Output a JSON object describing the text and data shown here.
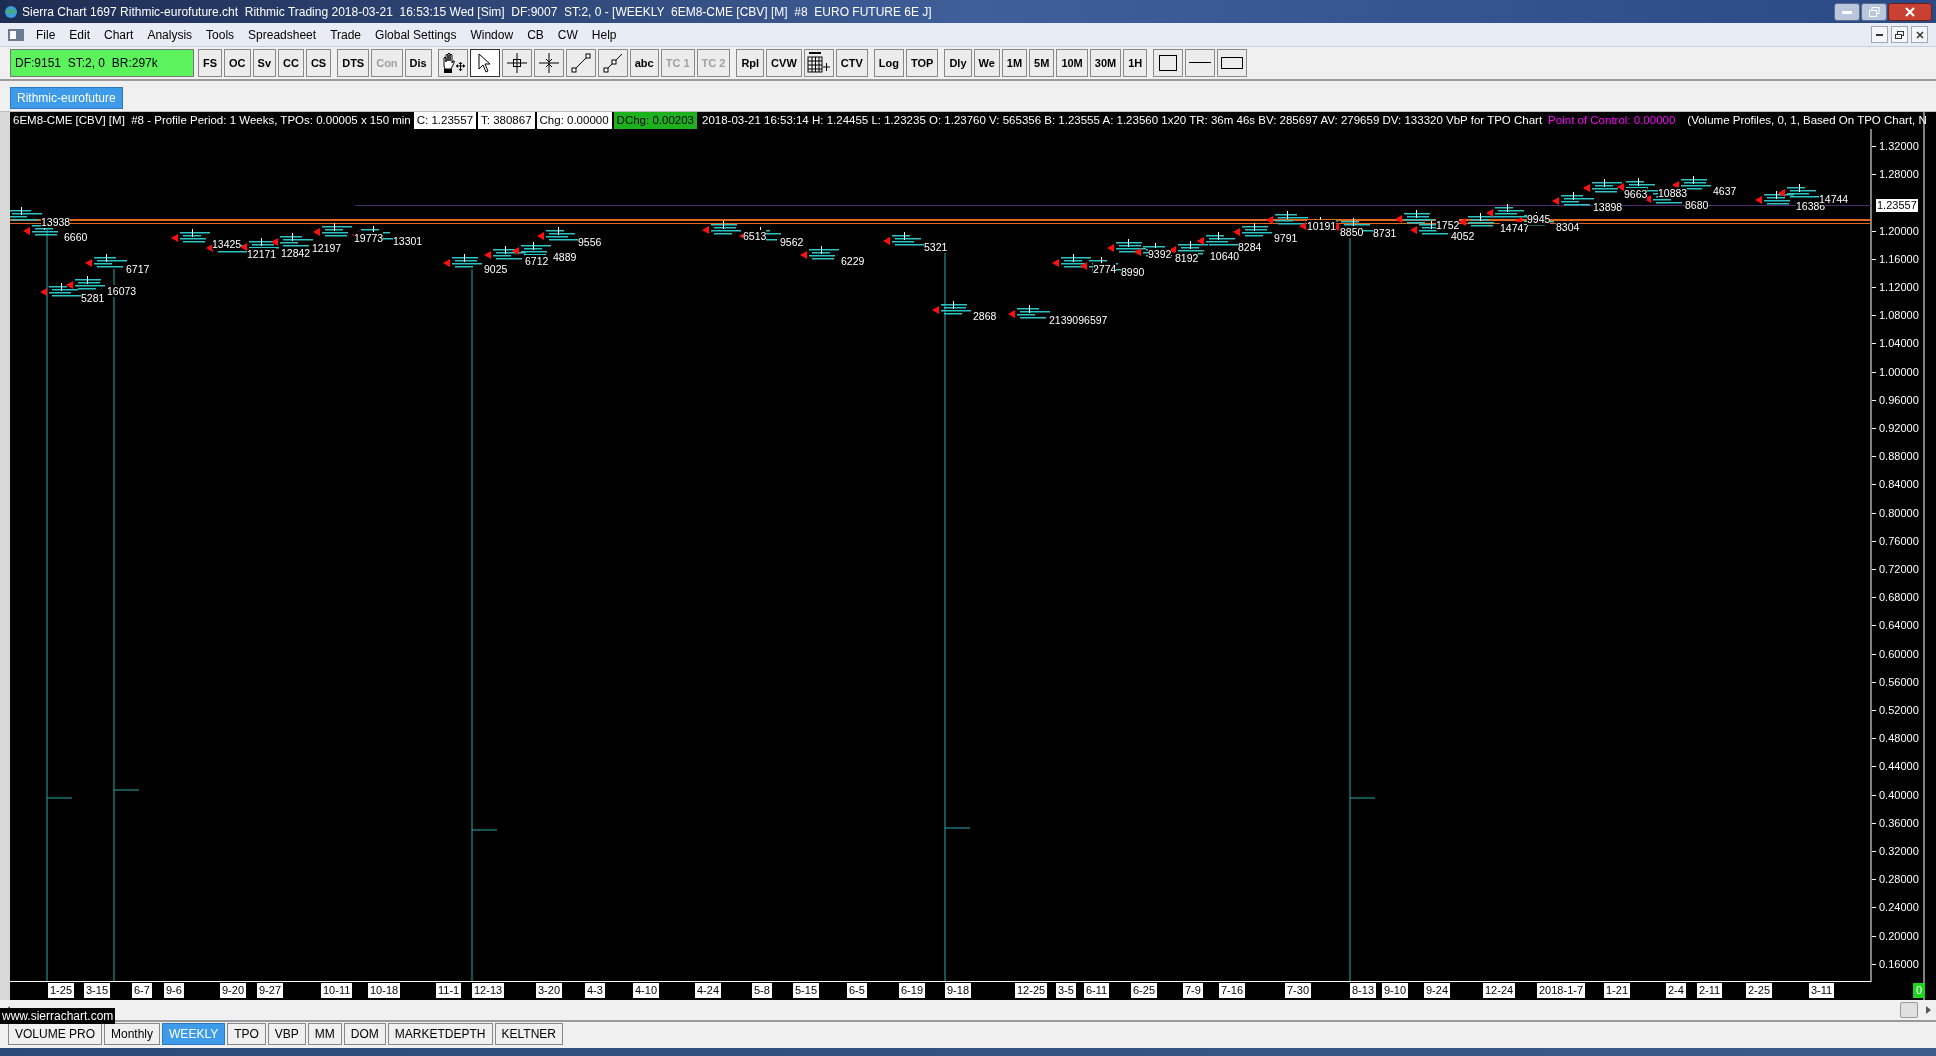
{
  "window": {
    "title": "Sierra Chart 1697 Rithmic-eurofuture.cht  Rithmic Trading 2018-03-21  16:53:15 Wed [Sim]  DF:9007  ST:2, 0 - [WEEKLY  6EM8-CME [CBV] [M]  #8  EURO FUTURE 6E J]"
  },
  "menu": [
    "File",
    "Edit",
    "Chart",
    "Analysis",
    "Tools",
    "Spreadsheet",
    "Trade",
    "Global Settings",
    "Window",
    "CB",
    "CW",
    "Help"
  ],
  "status_box": "DF:9151  ST:2, 0  BR:297k",
  "toolbar": [
    {
      "kind": "text",
      "label": "FS",
      "disabled": false,
      "selected": false
    },
    {
      "kind": "text",
      "label": "OC",
      "disabled": false,
      "selected": false
    },
    {
      "kind": "text",
      "label": "Sv",
      "disabled": false,
      "selected": false
    },
    {
      "kind": "text",
      "label": "CC",
      "disabled": false,
      "selected": false
    },
    {
      "kind": "text",
      "label": "CS",
      "disabled": false,
      "selected": false
    },
    {
      "kind": "text",
      "label": "DTS",
      "disabled": false,
      "selected": false
    },
    {
      "kind": "text",
      "label": "Con",
      "disabled": true,
      "selected": false
    },
    {
      "kind": "text",
      "label": "Dis",
      "disabled": false,
      "selected": false
    },
    {
      "kind": "hand",
      "disabled": false,
      "selected": false
    },
    {
      "kind": "pointer",
      "disabled": false,
      "selected": true
    },
    {
      "kind": "crosshair",
      "disabled": false,
      "selected": false
    },
    {
      "kind": "marker",
      "disabled": false,
      "selected": false
    },
    {
      "kind": "line",
      "disabled": false,
      "selected": false
    },
    {
      "kind": "ray",
      "disabled": false,
      "selected": false
    },
    {
      "kind": "text",
      "label": "abc",
      "disabled": false,
      "selected": false
    },
    {
      "kind": "text",
      "label": "TC 1",
      "disabled": true,
      "selected": false
    },
    {
      "kind": "text",
      "label": "TC 2",
      "disabled": true,
      "selected": false
    },
    {
      "kind": "text",
      "label": "Rpl",
      "disabled": false,
      "selected": false
    },
    {
      "kind": "text",
      "label": "CVW",
      "disabled": false,
      "selected": false
    },
    {
      "kind": "grid",
      "disabled": false,
      "selected": false
    },
    {
      "kind": "text",
      "label": "CTV",
      "disabled": false,
      "selected": false
    },
    {
      "kind": "text",
      "label": "Log",
      "disabled": false,
      "selected": false
    },
    {
      "kind": "text",
      "label": "TOP",
      "disabled": false,
      "selected": false
    },
    {
      "kind": "text",
      "label": "Dly",
      "disabled": false,
      "selected": false
    },
    {
      "kind": "text",
      "label": "We",
      "disabled": false,
      "selected": false
    },
    {
      "kind": "text",
      "label": "1M",
      "disabled": false,
      "selected": false
    },
    {
      "kind": "text",
      "label": "5M",
      "disabled": false,
      "selected": false
    },
    {
      "kind": "text",
      "label": "10M",
      "disabled": false,
      "selected": false
    },
    {
      "kind": "text",
      "label": "30M",
      "disabled": false,
      "selected": false
    },
    {
      "kind": "text",
      "label": "1H",
      "disabled": false,
      "selected": false
    },
    {
      "kind": "rectangle",
      "disabled": false,
      "selected": false
    },
    {
      "kind": "hline",
      "disabled": false,
      "selected": false
    },
    {
      "kind": "box",
      "disabled": false,
      "selected": false
    }
  ],
  "chart_tabs": [
    {
      "label": "Rithmic-eurofuture",
      "selected": true
    }
  ],
  "info_line": [
    {
      "kind": "plain",
      "text": "6EM8-CME [CBV] [M]  #8 - Profile Period: 1 Weeks, TPOs: 0.00005 x 150 min"
    },
    {
      "kind": "boxed",
      "text": "C: 1.23557"
    },
    {
      "kind": "boxed",
      "text": "T: 380867"
    },
    {
      "kind": "boxed",
      "text": "Chg: 0.00000"
    },
    {
      "kind": "positive",
      "text": "DChg: 0.00203"
    },
    {
      "kind": "plain",
      "text": "2018-03-21 16:53:14 H: 1.24455 L: 1.23235 O: 1.23760 V: 565356 B: 1.23555 A: 1.23560 1x20 TR: 36m 46s BV: 285697 AV: 279659 DV: 133320 VbP for TPO Chart"
    },
    {
      "kind": "highlight",
      "text": "Point of Control: 0.00000"
    },
    {
      "kind": "plain",
      "text": "(Volume Profiles, 0, 1, Based On TPO Chart, N"
    }
  ],
  "volume_labels": [
    "13938",
    "6660",
    "5281",
    "16073",
    "6717",
    "13425",
    "12171",
    "12842",
    "12197",
    "19773",
    "13301",
    "9025",
    "6712",
    "4889",
    "9556",
    "6513",
    "9562",
    "6229",
    "5321",
    "2868",
    "2139096597",
    "2774",
    "8990",
    "9392",
    "8192",
    "10640",
    "8284",
    "9791",
    "10191",
    "8850",
    "8731",
    "1752",
    "4052",
    "14747",
    "9945",
    "8304",
    "13898",
    "9663",
    "10883",
    "4637",
    "8680",
    "16386",
    "14744"
  ],
  "price_axis": {
    "labels": [
      "1.32000",
      "1.28000",
      "1.20000",
      "1.16000",
      "1.12000",
      "1.08000",
      "1.04000",
      "1.00000",
      "0.96000",
      "0.92000",
      "0.88000",
      "0.84000",
      "0.80000",
      "0.76000",
      "0.72000",
      "0.68000",
      "0.64000",
      "0.60000",
      "0.56000",
      "0.52000",
      "0.48000",
      "0.44000",
      "0.40000",
      "0.36000",
      "0.32000",
      "0.28000",
      "0.24000",
      "0.20000",
      "0.16000"
    ],
    "current_price": "1.23557"
  },
  "date_axis": {
    "labels": [
      "1-25",
      "3-15",
      "6-7",
      "9-6",
      "9-20",
      "9-27",
      "10-11",
      "10-18",
      "11-1",
      "12-13",
      "3-20",
      "4-3",
      "4-10",
      "4-24",
      "5-8",
      "5-15",
      "6-5",
      "6-19",
      "9-18",
      "12-25",
      "3-5",
      "6-11",
      "6-25",
      "7-9",
      "7-16",
      "7-30",
      "8-13",
      "9-10",
      "9-24",
      "12-24",
      "2018-1-7",
      "1-21",
      "2-4",
      "2-11",
      "2-25",
      "3-11"
    ]
  },
  "scale_indicator": "0",
  "bottom_tabs": [
    {
      "label": "VOLUME PRO",
      "selected": false
    },
    {
      "label": "Monthly",
      "selected": false
    },
    {
      "label": "WEEKLY",
      "selected": true
    },
    {
      "label": "TPO",
      "selected": false
    },
    {
      "label": "VBP",
      "selected": false
    },
    {
      "label": "MM",
      "selected": false
    },
    {
      "label": "DOM",
      "selected": false
    },
    {
      "label": "MARKETDEPTH",
      "selected": false
    },
    {
      "label": "KELTNER",
      "selected": false
    }
  ],
  "tooltip": "www.sierrachart.com"
}
